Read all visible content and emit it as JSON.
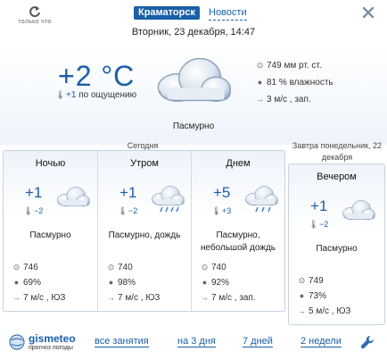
{
  "header": {
    "refresh_caption": "только что",
    "city_tab": "Краматорск",
    "news_tab": "Новости",
    "datetime": "Вторник, 23 декабря, 14:47"
  },
  "now": {
    "temperature": "+2 °C",
    "feels_like_value": "+1",
    "feels_like_label": "по ощущению",
    "condition": "Пасмурно",
    "pressure": "749 мм рт. ст.",
    "humidity": "81 % влажность",
    "wind": "3 м/с , зап."
  },
  "today_label": "Сегодня",
  "tomorrow_label": "Завтра понедельник, 22 декабря",
  "periods": [
    {
      "name": "Ночью",
      "temp": "+1",
      "feels": "−2",
      "condition": "Пасмурно",
      "pressure": "746",
      "humidity": "69%",
      "wind": "7 м/с , ЮЗ",
      "rain": false
    },
    {
      "name": "Утром",
      "temp": "+1",
      "feels": "−2",
      "condition": "Пасмурно, дождь",
      "pressure": "740",
      "humidity": "98%",
      "wind": "7 м/с , ЮЗ",
      "rain": true
    },
    {
      "name": "Днем",
      "temp": "+5",
      "feels": "+3",
      "condition": "Пасмурно, небольшой дождь",
      "pressure": "740",
      "humidity": "92%",
      "wind": "7 м/с , зап.",
      "rain": true
    },
    {
      "name": "Вечером",
      "temp": "+1",
      "feels": "−2",
      "condition": "Пасмурно",
      "pressure": "749",
      "humidity": "73%",
      "wind": "5 м/с , ЮЗ",
      "rain": false
    }
  ],
  "footer": {
    "logo_name": "gismeteo",
    "logo_sub": "прогноз погоды",
    "link_now": "все занятия",
    "link_3days": "на 3 дня",
    "link_7days": "7 дней",
    "link_2weeks": "2 недели"
  },
  "colors": {
    "accent": "#1a5fa8",
    "border": "#c8d3e0"
  },
  "icons": {
    "refresh": "refresh-icon",
    "close": "close-icon",
    "settings": "wrench-icon",
    "pressure": "gauge-icon",
    "humidity": "drop-icon",
    "wind": "arrow-right-icon",
    "feels": "thermometer-icon"
  }
}
